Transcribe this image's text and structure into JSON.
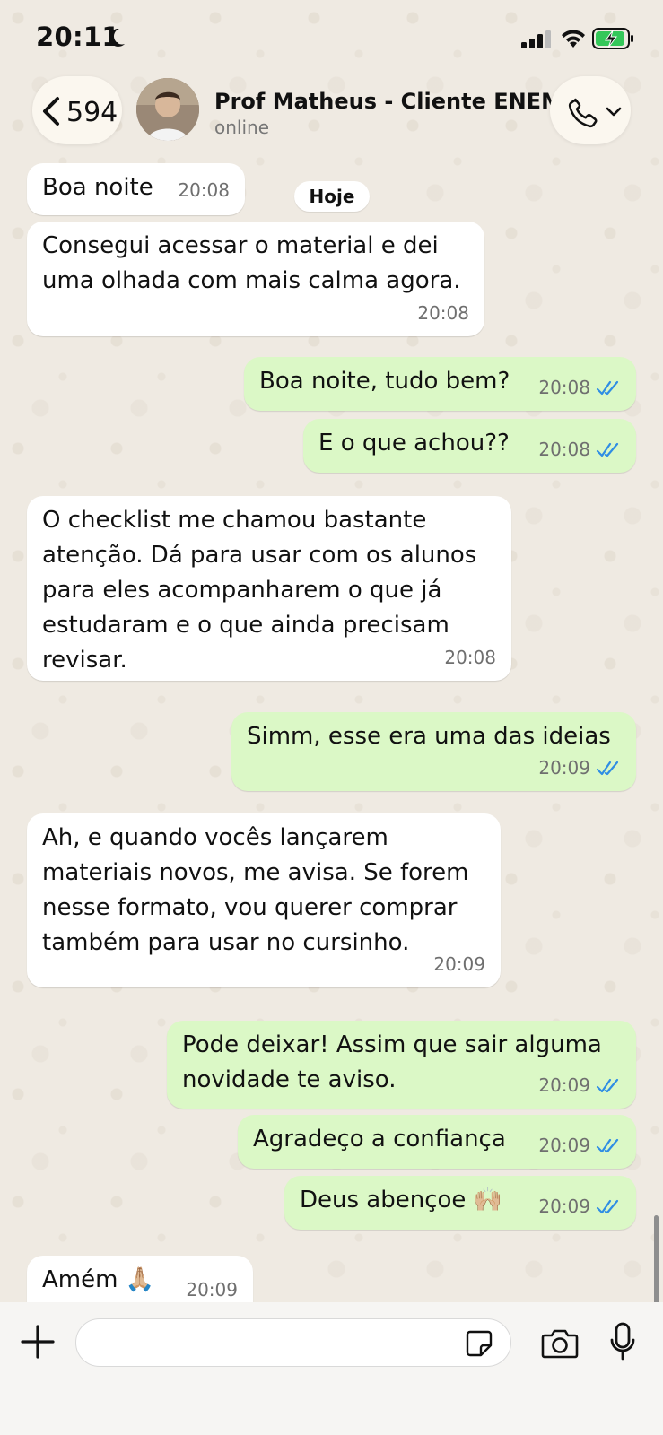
{
  "status_bar": {
    "time": "20:11",
    "moon_icon": "moon-icon",
    "battery_state": "charging"
  },
  "header": {
    "back_count": "594",
    "contact_name": "Prof Matheus - Cliente ENEM",
    "contact_status": "online"
  },
  "day_chip": "Hoje",
  "messages": [
    {
      "dir": "in",
      "text": "Boa noite",
      "time": "20:08"
    },
    {
      "dir": "in",
      "text": "Consegui acessar o material e dei\numa olhada com mais calma agora.",
      "time": "20:08"
    },
    {
      "dir": "out",
      "text": "Boa noite, tudo bem?",
      "time": "20:08",
      "read": true
    },
    {
      "dir": "out",
      "text": "E o que achou??",
      "time": "20:08",
      "read": true
    },
    {
      "dir": "in",
      "text": "O checklist me chamou bastante\natenção. Dá para usar com os alunos\npara eles acompanharem o que já\nestudaram e o que ainda precisam\nrevisar.",
      "time": "20:08"
    },
    {
      "dir": "out",
      "text": "Simm, esse era uma das ideias",
      "time": "20:09",
      "read": true
    },
    {
      "dir": "in",
      "text": "Ah, e quando vocês lançarem\nmateriais novos, me avisa. Se forem\nnesse formato, vou querer comprar\ntambém para usar no cursinho.",
      "time": "20:09"
    },
    {
      "dir": "out",
      "text": "Pode deixar! Assim que sair alguma\nnovidade te aviso.",
      "time": "20:09",
      "read": true
    },
    {
      "dir": "out",
      "text": "Agradeço a confiança",
      "time": "20:09",
      "read": true
    },
    {
      "dir": "out",
      "text": "Deus abençoe 🙌🏼",
      "time": "20:09",
      "read": true
    },
    {
      "dir": "in",
      "text": "Amém 🙏🏼",
      "time": "20:09"
    }
  ],
  "composer": {
    "placeholder": ""
  },
  "colors": {
    "incoming": "#ffffff",
    "outgoing": "#dbf8c6",
    "read_tick": "#2f8de4"
  }
}
